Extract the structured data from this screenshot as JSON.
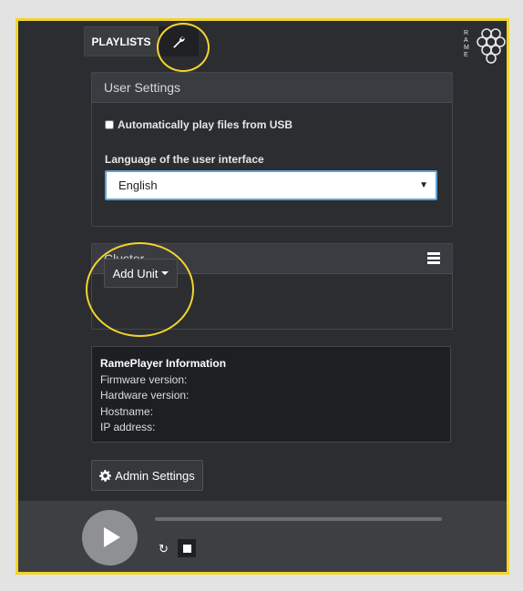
{
  "tabs": {
    "playlists": "PLAYLISTS",
    "settings_icon": "wrench-icon"
  },
  "brand": {
    "logo_text": "RAME"
  },
  "user_settings": {
    "title": "User Settings",
    "autoplay_label": "Automatically play files from USB",
    "autoplay_checked": false,
    "language_label": "Language of the user interface",
    "language_value": "English"
  },
  "cluster": {
    "title": "Cluster",
    "menu_icon": "hamburger-menu-icon",
    "add_unit_label": "Add Unit"
  },
  "info": {
    "title": "RamePlayer Information",
    "firmware": "Firmware version:",
    "hardware": "Hardware version:",
    "hostname": "Hostname:",
    "ip": "IP address:"
  },
  "admin": {
    "label": "Admin Settings",
    "icon": "gear-icon"
  },
  "player": {
    "play_icon": "play-icon",
    "refresh_icon": "refresh-icon",
    "stop_icon": "stop-icon",
    "progress": 0
  },
  "colors": {
    "highlight": "#f2d52c",
    "background": "#2b2d30",
    "select_border": "#5ea3d8"
  }
}
